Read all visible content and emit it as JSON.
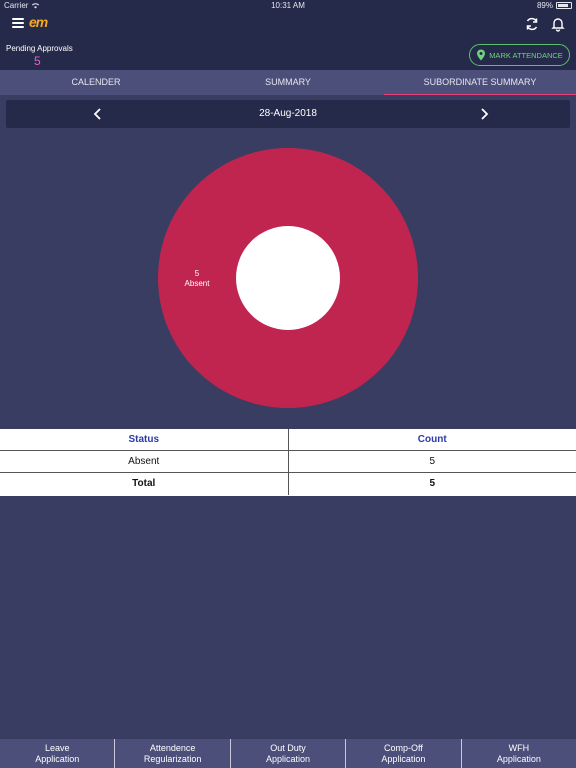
{
  "status_bar": {
    "carrier": "Carrier",
    "time": "10:31 AM",
    "battery": "89%"
  },
  "header": {
    "logo": "em",
    "icons": [
      "menu-icon",
      "refresh-icon",
      "bell-icon"
    ]
  },
  "approvals": {
    "label": "Pending Approvals",
    "count": "5"
  },
  "mark_attendance": {
    "label": "MARK ATTENDANCE",
    "icon": "location-pin-icon",
    "accent": "#6fd27f"
  },
  "tabs": [
    {
      "label": "CALENDER",
      "active": false
    },
    {
      "label": "SUMMARY",
      "active": false
    },
    {
      "label": "SUBORDINATE SUMMARY",
      "active": true
    }
  ],
  "date_nav": {
    "date": "28-Aug-2018"
  },
  "chart_data": {
    "type": "pie",
    "categories": [
      "Absent"
    ],
    "values": [
      5
    ],
    "colors": [
      "#c02550"
    ],
    "donut": true,
    "labels": [
      {
        "value": "5",
        "name": "Absent"
      }
    ]
  },
  "table": {
    "headers": [
      "Status",
      "Count"
    ],
    "rows": [
      {
        "status": "Absent",
        "count": "5"
      },
      {
        "status": "Total",
        "count": "5"
      }
    ]
  },
  "bottom_nav": [
    {
      "line1": "Leave",
      "line2": "Application"
    },
    {
      "line1": "Attendence",
      "line2": "Regularization"
    },
    {
      "line1": "Out Duty",
      "line2": "Application"
    },
    {
      "line1": "Comp-Off",
      "line2": "Application"
    },
    {
      "line1": "WFH",
      "line2": "Application"
    }
  ],
  "colors": {
    "background": "#3a3d62",
    "bar": "#262a4a",
    "tab_bg": "#4b4f7a",
    "accent_pink": "#e55fc9",
    "active_tab_underline": "#e7407a"
  }
}
